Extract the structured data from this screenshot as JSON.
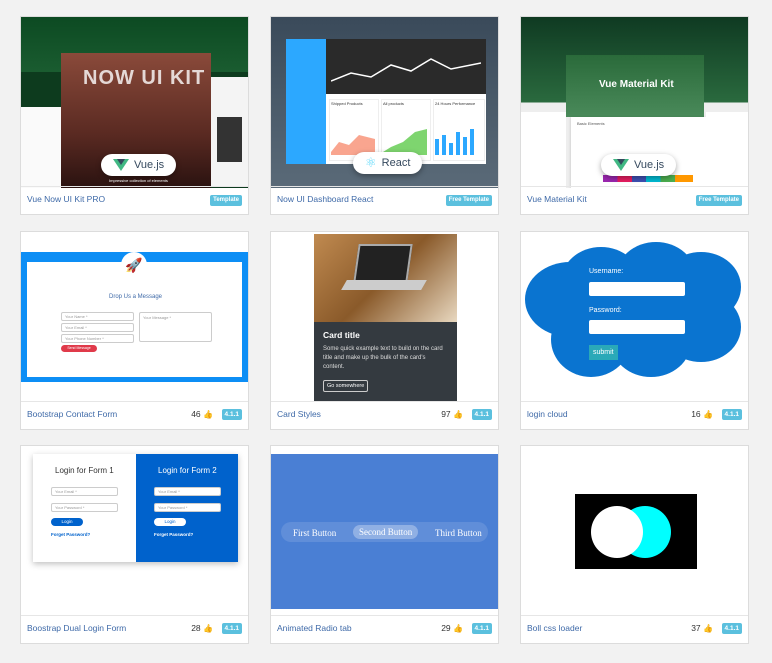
{
  "cards": [
    {
      "title": "Vue Now UI Kit PRO",
      "badge": "Template",
      "hero": "NOW UI KIT",
      "subtitle": "Impressive collection of elements",
      "pill": "Vue.js"
    },
    {
      "title": "Now UI Dashboard React",
      "badge": "Free Template",
      "pill": "React",
      "panels": [
        "Shipped Products",
        "All products",
        "24 Hours Performance"
      ]
    },
    {
      "title": "Vue Material Kit",
      "badge": "Free Template",
      "hero": "Vue Material Kit",
      "section": "Basic Elements",
      "pill": "Vue.js"
    },
    {
      "title": "Bootstrap Contact Form",
      "likes": "46",
      "version": "4.1.1",
      "heading": "Drop Us a Message",
      "fields": [
        "Your Name *",
        "Your Email *",
        "Your Phone Number *",
        "Your Message *"
      ],
      "button": "Send Message"
    },
    {
      "title": "Card Styles",
      "likes": "97",
      "version": "4.1.1",
      "card_title": "Card title",
      "card_text": "Some quick example text to build on the card title and make up the bulk of the card's content.",
      "card_button": "Go somewhere"
    },
    {
      "title": "login cloud",
      "likes": "16",
      "version": "4.1.1",
      "username_label": "Username:",
      "password_label": "Password:",
      "submit": "submit"
    },
    {
      "title": "Boostrap Dual Login Form",
      "likes": "28",
      "version": "4.1.1",
      "form1": "Login for Form 1",
      "form2": "Login for Form 2",
      "email": "Your Email *",
      "password": "Your Password *",
      "login": "Login",
      "forgot": "Forget Password?"
    },
    {
      "title": "Animated Radio tab",
      "likes": "29",
      "version": "4.1.1",
      "options": [
        "First Button",
        "Second Button",
        "Third Button"
      ]
    },
    {
      "title": "Boll css loader",
      "likes": "37",
      "version": "4.1.1"
    }
  ],
  "colors": {
    "accent": "#5bc0de",
    "link": "#3f6aa8",
    "cloud": "#0a74d0",
    "loader": "#00ffff"
  }
}
